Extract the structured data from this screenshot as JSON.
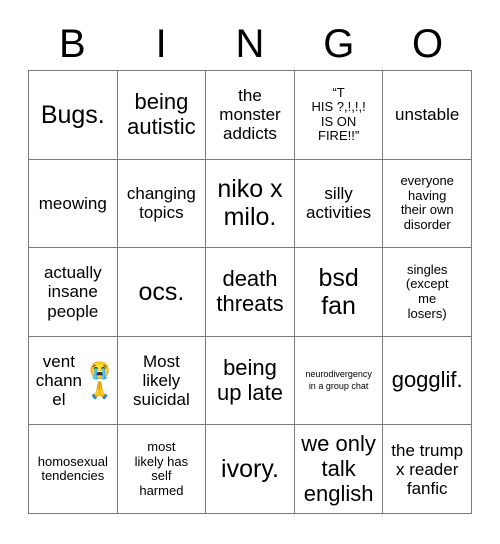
{
  "card": {
    "title": "BINGO",
    "header_letters": [
      "B",
      "I",
      "N",
      "G",
      "O"
    ],
    "grid_size": "5x5",
    "colors": {
      "background": "#ffffff",
      "text": "#000000",
      "grid_line": "#7a7a7a"
    }
  },
  "cells": [
    {
      "text": "Bugs.",
      "size": "xl"
    },
    {
      "text": "being\nautistic",
      "size": "lg"
    },
    {
      "text": "the\nmonster\naddicts",
      "size": "md"
    },
    {
      "text": "“T\nHIS ?,!,!,!\nIS ON\nFIRE!!”",
      "size": "sm"
    },
    {
      "text": "unstable",
      "size": "md"
    },
    {
      "text": "meowing",
      "size": "md"
    },
    {
      "text": "changing\ntopics",
      "size": "md"
    },
    {
      "text": "niko x\nmilo.",
      "size": "xl"
    },
    {
      "text": "silly\nactivities",
      "size": "md"
    },
    {
      "text": "everyone\nhaving\ntheir own\ndisorder",
      "size": "sm"
    },
    {
      "text": "actually\ninsane\npeople",
      "size": "md"
    },
    {
      "text": "ocs.",
      "size": "xl"
    },
    {
      "text": "death\nthreats",
      "size": "lg"
    },
    {
      "text": "bsd\nfan",
      "size": "xl"
    },
    {
      "text": "singles\n(except\nme\nlosers)",
      "size": "sm"
    },
    {
      "text": "vent\nchannel",
      "size": "md",
      "emoji": "😭🙏"
    },
    {
      "text": "Most\nlikely\nsuicidal",
      "size": "md"
    },
    {
      "text": "being\nup late",
      "size": "lg"
    },
    {
      "text": "neurodivergency\nin a group chat",
      "size": "xs"
    },
    {
      "text": "gogglif.",
      "size": "lg"
    },
    {
      "text": "homosexual\ntendencies",
      "size": "sm"
    },
    {
      "text": "most\nlikely has\nself\nharmed",
      "size": "sm"
    },
    {
      "text": "ivory.",
      "size": "xl"
    },
    {
      "text": "we only\ntalk\nenglish",
      "size": "lg"
    },
    {
      "text": "the trump\nx reader\nfanfic",
      "size": "md"
    }
  ]
}
